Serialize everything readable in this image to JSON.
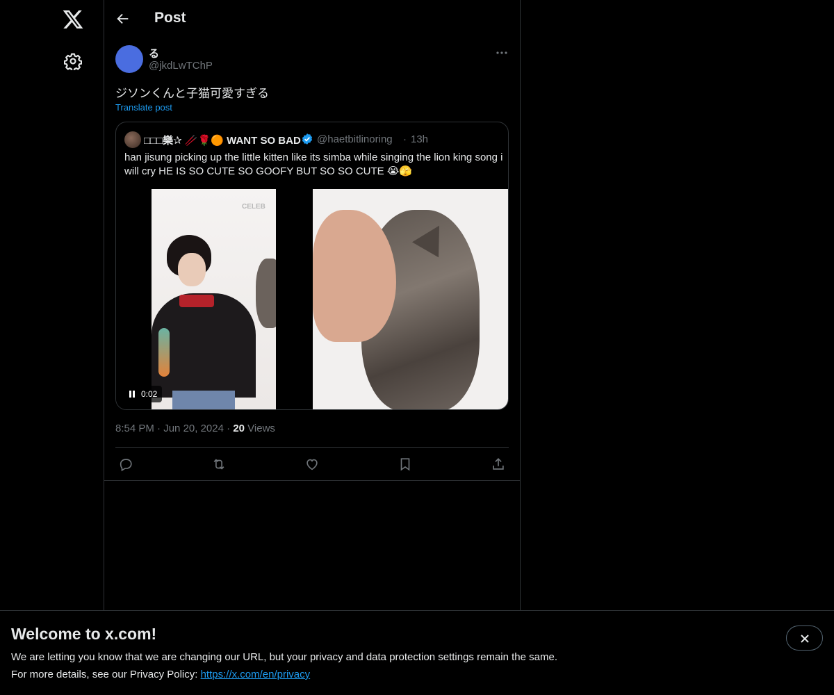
{
  "header": {
    "title": "Post"
  },
  "post": {
    "display_name": "る",
    "handle": "@jkdLwTChP",
    "text": "ジソンくんと子猫可愛すぎる",
    "translate_label": "Translate post",
    "time": "8:54 PM",
    "date": "Jun 20, 2024",
    "views_count": "20",
    "views_label": "Views",
    "separator": "·"
  },
  "quote": {
    "display_name": "□□□樂✰ 🥢🌹🟠 WANT SO BAD",
    "handle": "@haetbitlinoring",
    "separator": "·",
    "time": "13h",
    "text": "han jisung picking up the little kitten like its simba while singing the lion king song i will cry HE IS SO CUTE SO GOOFY BUT SO SO CUTE 😭🫣",
    "video_time": "0:02",
    "watermark": "CELEB"
  },
  "banner": {
    "title": "Welcome to x.com!",
    "line1": "We are letting you know that we are changing our URL, but your privacy and data protection settings remain the same.",
    "line2_prefix": "For more details, see our Privacy Policy: ",
    "link": "https://x.com/en/privacy"
  },
  "icons": {
    "logo": "x-logo-icon",
    "settings": "gear-icon",
    "back": "back-arrow-icon",
    "more": "more-dots-icon",
    "reply": "reply-icon",
    "repost": "repost-icon",
    "like": "heart-icon",
    "bookmark": "bookmark-icon",
    "share": "share-icon"
  },
  "colors": {
    "background": "#000000",
    "accent": "#1d9bf0",
    "text": "#e7e9ea",
    "muted": "#71767b",
    "border": "#2f3336",
    "avatar": "#4a6de0"
  }
}
